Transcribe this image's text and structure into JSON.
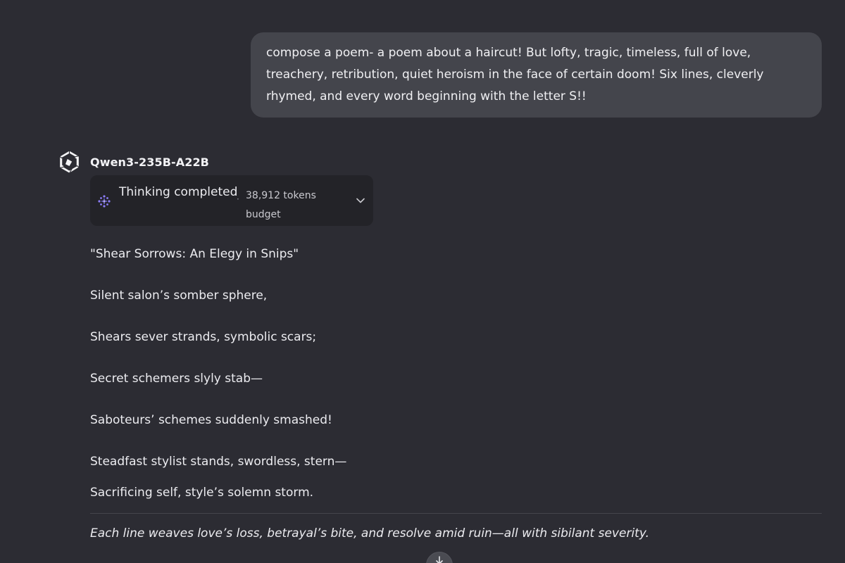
{
  "user_message": {
    "text": "compose a poem- a poem about a haircut! But lofty, tragic, timeless, full of love, treachery, retribution, quiet heroism in the face of certain doom! Six lines, cleverly rhymed, and every word beginning with the letter S!!"
  },
  "assistant": {
    "model_name": "Qwen3-235B-A22B",
    "logo_icon": "qwen-logo-icon",
    "thinking": {
      "label": "Thinking completed",
      "separator": "·",
      "tokens": "38,912 tokens budget",
      "icon": "thinking-sparkle-icon",
      "toggle_icon": "chevron-down-icon"
    },
    "poem": {
      "title": "\"Shear Sorrows: An Elegy in Snips\"",
      "lines": [
        "Silent salon’s somber sphere,",
        "Shears sever strands, symbolic scars;",
        "Secret schemers slyly stab—",
        "Saboteurs’ schemes suddenly smashed!",
        "Steadfast stylist stands, swordless, stern—",
        "Sacrificing self, style’s solemn storm."
      ]
    },
    "summary": "Each line weaves love’s loss, betrayal’s bite, and resolve amid ruin—all with sibilant severity."
  },
  "scroll_button_icon": "arrow-down-icon",
  "colors": {
    "background": "#2c2c33",
    "user_bubble": "#44454c",
    "thinking_card": "#232328",
    "thinking_icon": "#8b7cf6",
    "text": "#ececf0",
    "muted_text": "#c9c9cf"
  }
}
